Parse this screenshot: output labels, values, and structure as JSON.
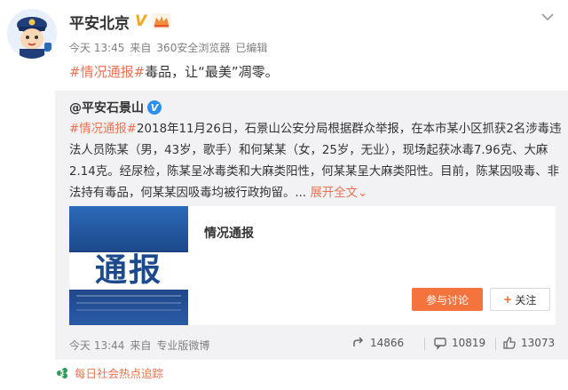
{
  "post": {
    "author": "平安北京",
    "verified_mark": "V",
    "time": "今天 13:45",
    "source_prefix": "来自",
    "source": "360安全浏览器",
    "edited": "已编辑",
    "hashtag": "#情况通报#",
    "text_rest": "毒品，让“最美”凋零。"
  },
  "repost": {
    "author": "@平安石景山",
    "verified_mark": "V",
    "hashtag": "#情况通报#",
    "body": "2018年11月26日，石景山公安分局根据群众举报，在本市某小区抓获2名涉毒违法人员陈某（男，43岁，歌手）和何某某（女，25岁，无业），现场起获冰毒7.96克、大麻2.14克。经尿检，陈某呈冰毒类和大麻类阳性，何某某呈大麻类阳性。目前，陈某因吸毒、非法持有毒品，何某某因吸毒均被行政拘留。...",
    "expand": "展开全文",
    "expand_arrow": "⌄",
    "card": {
      "image_text": "通报",
      "title": "情况通报",
      "discuss_button": "参与讨论",
      "follow_plus": "+",
      "follow_button": "关注"
    },
    "time": "今天 13:44",
    "source_prefix": "来自",
    "source": "专业版微博",
    "shares": "14866",
    "comments": "10819",
    "likes": "13073"
  },
  "hot_topic": "每日社会热点追踪",
  "colors": {
    "accent": "#eb7350",
    "button_orange": "#f5743d",
    "repost_bg": "#f2f2f5",
    "verified_blue": "#2b8ff1",
    "verified_gold": "#f5a623"
  },
  "icons": [
    "police-avatar",
    "crown-icon",
    "chevron-down-icon",
    "share-icon",
    "comment-icon",
    "like-icon",
    "hot-topic-icon"
  ]
}
